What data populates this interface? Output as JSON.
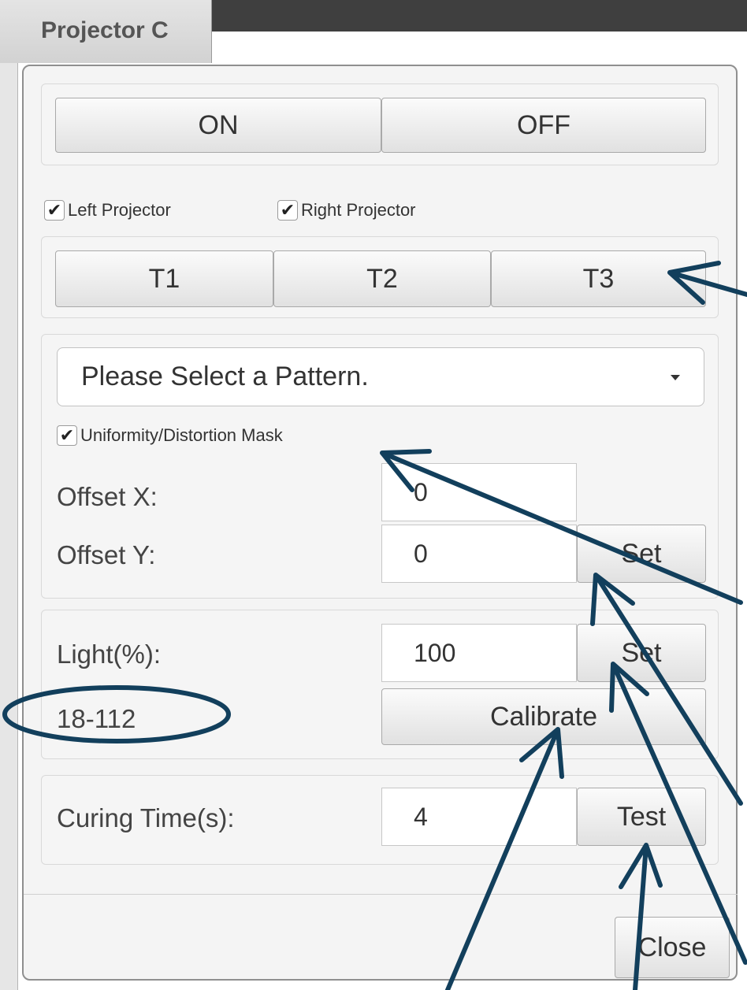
{
  "window": {
    "title": "Projector C"
  },
  "power": {
    "on_label": "ON",
    "off_label": "OFF"
  },
  "projectors": {
    "left_label": "Left Projector",
    "left_checked": true,
    "right_label": "Right Projector",
    "right_checked": true
  },
  "tests": {
    "t1_label": "T1",
    "t2_label": "T2",
    "t3_label": "T3"
  },
  "pattern": {
    "selected": "Please Select a Pattern.",
    "mask_label": "Uniformity/Distortion Mask",
    "mask_checked": true,
    "offset_x_label": "Offset X:",
    "offset_x_value": "0",
    "offset_y_label": "Offset Y:",
    "offset_y_value": "0",
    "set_label": "Set"
  },
  "light": {
    "label": "Light(%):",
    "value": "100",
    "set_label": "Set",
    "range_text": "18-112",
    "calibrate_label": "Calibrate"
  },
  "curing": {
    "label": "Curing Time(s):",
    "value": "4",
    "test_label": "Test"
  },
  "footer": {
    "close_label": "Close"
  },
  "annotation_color": "#123f5c"
}
